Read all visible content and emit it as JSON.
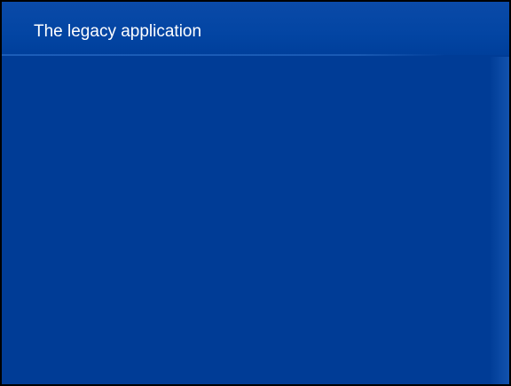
{
  "slide": {
    "title": "The legacy application",
    "background_color": "#003c96",
    "border_color": "#000000",
    "title_color": "#ffffff"
  }
}
